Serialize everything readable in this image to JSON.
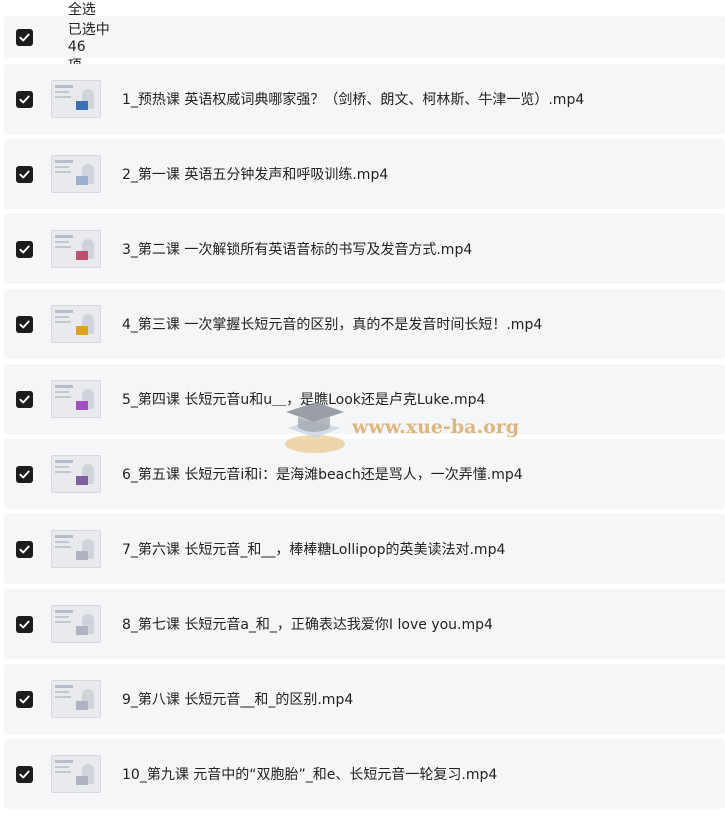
{
  "header": {
    "select_all_label": "全选",
    "selected_prefix": "已选中",
    "selected_count": "46",
    "selected_suffix": "项"
  },
  "files": [
    {
      "name": "1_预热课 英语权威词典哪家强？（剑桥、朗文、柯林斯、牛津一览）.mp4",
      "thumb_accent": "#3b6fb6"
    },
    {
      "name": "2_第一课 英语五分钟发声和呼吸训练.mp4",
      "thumb_accent": "#9ab0d0"
    },
    {
      "name": "3_第二课 一次解锁所有英语音标的书写及发音方式.mp4",
      "thumb_accent": "#c05070"
    },
    {
      "name": "4_第三课 一次掌握长短元音的区别，真的不是发音时间长短！.mp4",
      "thumb_accent": "#e0a020"
    },
    {
      "name": "5_第四课 长短元音u和u＿，是瞧Look还是卢克Luke.mp4",
      "thumb_accent": "#a050c0"
    },
    {
      "name": "6_第五课 长短元音i和i：是海滩beach还是骂人，一次弄懂.mp4",
      "thumb_accent": "#8060a0"
    },
    {
      "name": "7_第六课 长短元音_和__，棒棒糖Lollipop的英美读法对.mp4",
      "thumb_accent": "#b0b4c0"
    },
    {
      "name": "8_第七课 长短元音a_和_，正确表达我爱你I love you.mp4",
      "thumb_accent": "#b0b4c0"
    },
    {
      "name": "9_第八课 长短元音__和_的区别.mp4",
      "thumb_accent": "#b0b4c0"
    },
    {
      "name": "10_第九课 元音中的“双胞胎”_和e、长短元音一轮复习.mp4",
      "thumb_accent": "#b0b4c0"
    }
  ],
  "watermark": {
    "text": "www.xue-ba.org"
  },
  "colors": {
    "row_bg": "#f4f6f8",
    "checkbox": "#1c1c1c",
    "watermark": "#d9a860"
  }
}
